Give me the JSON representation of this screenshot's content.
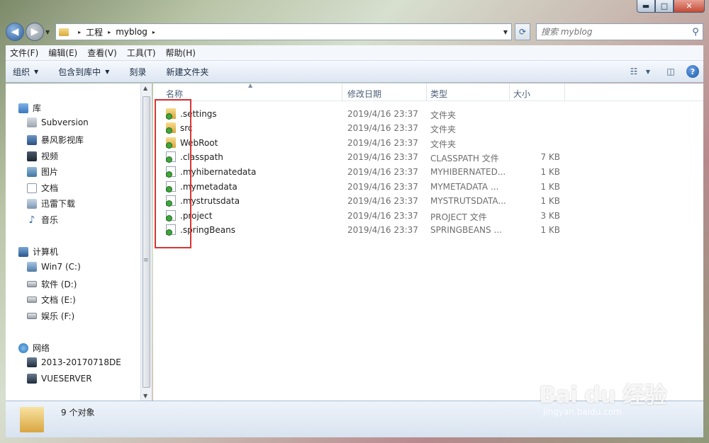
{
  "window": {
    "caption_min": "▬",
    "caption_max": "□",
    "caption_close": "✕"
  },
  "address": {
    "arrow": "▸",
    "crumbs": [
      "工程",
      "myblog"
    ],
    "search_placeholder": "搜索 myblog"
  },
  "menu": [
    "文件(F)",
    "编辑(E)",
    "查看(V)",
    "工具(T)",
    "帮助(H)"
  ],
  "toolbar": {
    "organize": "组织",
    "include_in_library": "包含到库中",
    "burn": "刻录",
    "new_folder": "新建文件夹",
    "help": "?"
  },
  "nav": {
    "libraries": {
      "title": "库",
      "items": [
        "Subversion",
        "暴风影视库",
        "视频",
        "图片",
        "文档",
        "迅雷下载",
        "音乐"
      ]
    },
    "computer": {
      "title": "计算机",
      "items": [
        "Win7 (C:)",
        "软件 (D:)",
        "文档 (E:)",
        "娱乐 (F:)"
      ]
    },
    "network": {
      "title": "网络",
      "items": [
        "2013-20170718DE",
        "VUESERVER"
      ]
    }
  },
  "columns": {
    "name": "名称",
    "date": "修改日期",
    "type": "类型",
    "size": "大小"
  },
  "files": [
    {
      "name": ".settings",
      "date": "2019/4/16 23:37",
      "type": "文件夹",
      "size": "",
      "kind": "folder"
    },
    {
      "name": "src",
      "date": "2019/4/16 23:37",
      "type": "文件夹",
      "size": "",
      "kind": "folder"
    },
    {
      "name": "WebRoot",
      "date": "2019/4/16 23:37",
      "type": "文件夹",
      "size": "",
      "kind": "folder"
    },
    {
      "name": ".classpath",
      "date": "2019/4/16 23:37",
      "type": "CLASSPATH 文件",
      "size": "7 KB",
      "kind": "file"
    },
    {
      "name": ".myhibernatedata",
      "date": "2019/4/16 23:37",
      "type": "MYHIBERNATED...",
      "size": "1 KB",
      "kind": "file"
    },
    {
      "name": ".mymetadata",
      "date": "2019/4/16 23:37",
      "type": "MYMETADATA ...",
      "size": "1 KB",
      "kind": "file"
    },
    {
      "name": ".mystrutsdata",
      "date": "2019/4/16 23:37",
      "type": "MYSTRUTSDATA...",
      "size": "1 KB",
      "kind": "file"
    },
    {
      "name": ".project",
      "date": "2019/4/16 23:37",
      "type": "PROJECT 文件",
      "size": "3 KB",
      "kind": "file"
    },
    {
      "name": ".springBeans",
      "date": "2019/4/16 23:37",
      "type": "SPRINGBEANS ...",
      "size": "1 KB",
      "kind": "file"
    }
  ],
  "details": {
    "count": "9 个对象"
  },
  "watermark": {
    "logo": "Bai du 经验",
    "url": "jingyan.baidu.com"
  },
  "colors": {
    "highlight_box": "#d93434",
    "svn_badge": "#3ea53a"
  }
}
